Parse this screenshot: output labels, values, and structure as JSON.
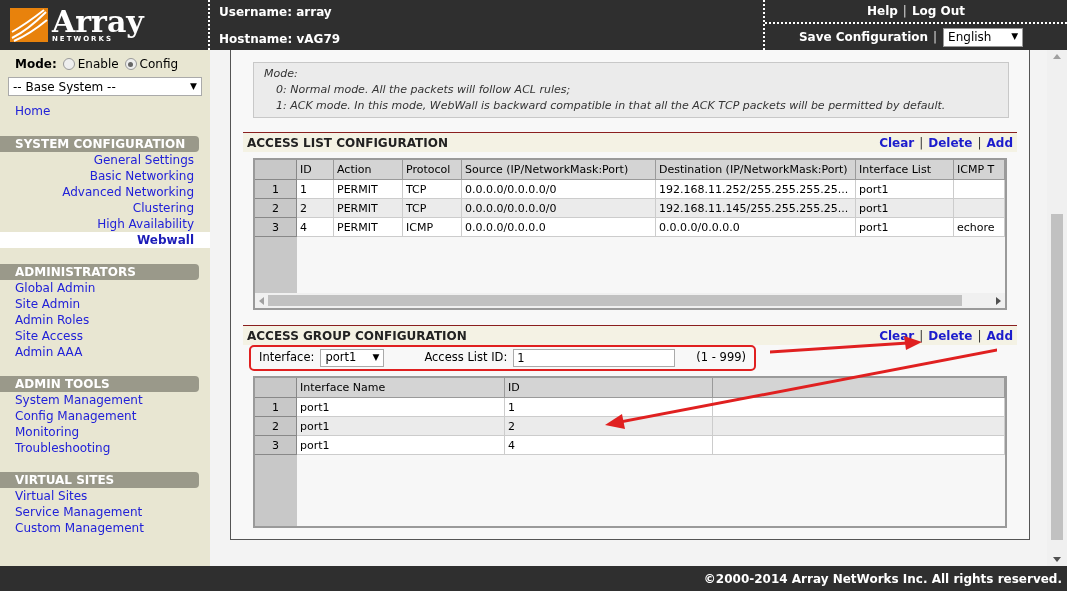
{
  "header": {
    "logo": {
      "name": "Array",
      "tagline": "NETWORKS"
    },
    "username": "Username: array",
    "hostname": "Hostname: vAG79",
    "top_links": [
      {
        "kind": "link",
        "text": "Help"
      },
      {
        "kind": "sep",
        "text": "|"
      },
      {
        "kind": "link",
        "text": "Log Out"
      }
    ],
    "save_links": [
      {
        "kind": "link",
        "text": "Save Configuration"
      },
      {
        "kind": "sep",
        "text": "|"
      }
    ],
    "language": {
      "value": "English",
      "caret": "▼"
    }
  },
  "sidebar": {
    "mode_label": "Mode:",
    "modes": [
      {
        "label": "Enable",
        "selected": false
      },
      {
        "label": "Config",
        "selected": true
      }
    ],
    "scope": {
      "value": "-- Base System --",
      "caret": "▼"
    },
    "home": "Home",
    "sections": [
      {
        "title": "SYSTEM CONFIGURATION",
        "items": [
          {
            "label": "General Settings",
            "selected": false
          },
          {
            "label": "Basic Networking",
            "selected": false
          },
          {
            "label": "Advanced Networking",
            "selected": false
          },
          {
            "label": "Clustering",
            "selected": false
          },
          {
            "label": "High Availability",
            "selected": false
          },
          {
            "label": "Webwall",
            "selected": true
          }
        ]
      },
      {
        "title": "ADMINISTRATORS",
        "items": [
          {
            "label": "Global Admin",
            "selected": false
          },
          {
            "label": "Site Admin",
            "selected": false
          },
          {
            "label": "Admin Roles",
            "selected": false
          },
          {
            "label": "Site Access",
            "selected": false
          },
          {
            "label": "Admin AAA",
            "selected": false
          }
        ]
      },
      {
        "title": "ADMIN TOOLS",
        "items": [
          {
            "label": "System Management",
            "selected": false
          },
          {
            "label": "Config Management",
            "selected": false
          },
          {
            "label": "Monitoring",
            "selected": false
          },
          {
            "label": "Troubleshooting",
            "selected": false
          }
        ]
      },
      {
        "title": "VIRTUAL SITES",
        "items": [
          {
            "label": "Virtual Sites",
            "selected": false
          },
          {
            "label": "Service Management",
            "selected": false
          },
          {
            "label": "Custom Management",
            "selected": false
          }
        ]
      }
    ]
  },
  "note": [
    "Mode:",
    "0: Normal mode. All the packets will follow ACL rules;",
    "1: ACK mode. In this mode, WebWall is backward compatible in that all the ACK TCP packets will be permitted by default."
  ],
  "access_list": {
    "title": "ACCESS LIST CONFIGURATION",
    "actions": [
      {
        "kind": "link",
        "text": "Clear"
      },
      {
        "kind": "sep",
        "text": "|"
      },
      {
        "kind": "link",
        "text": "Delete"
      },
      {
        "kind": "sep",
        "text": "|"
      },
      {
        "kind": "link",
        "text": "Add"
      }
    ],
    "columns": [
      "ID",
      "Action",
      "Protocol",
      "Source (IP/NetworkMask:Port)",
      "Destination (IP/NetworkMask:Port)",
      "Interface List",
      "ICMP T"
    ],
    "rows": [
      {
        "number": "1",
        "cells": [
          "1",
          "PERMIT",
          "TCP",
          "0.0.0.0/0.0.0.0/0",
          "192.168.11.252/255.255.255.25...",
          "port1",
          ""
        ]
      },
      {
        "number": "2",
        "cells": [
          "2",
          "PERMIT",
          "TCP",
          "0.0.0.0/0.0.0.0/0",
          "192.168.11.145/255.255.255.25...",
          "port1",
          ""
        ]
      },
      {
        "number": "3",
        "cells": [
          "4",
          "PERMIT",
          "ICMP",
          "0.0.0.0/0.0.0.0",
          "0.0.0.0/0.0.0.0",
          "port1",
          "echore"
        ]
      }
    ]
  },
  "access_group": {
    "title": "ACCESS GROUP CONFIGURATION",
    "actions": [
      {
        "kind": "link",
        "text": "Clear"
      },
      {
        "kind": "sep",
        "text": "|"
      },
      {
        "kind": "link",
        "text": "Delete"
      },
      {
        "kind": "sep",
        "text": "|"
      },
      {
        "kind": "link",
        "text": "Add"
      }
    ],
    "interface_label": "Interface:",
    "interface": {
      "value": "port1",
      "caret": "▼"
    },
    "list_id_label": "Access List ID:",
    "list_id": "1",
    "range": "(1 - 999)",
    "columns": [
      "Interface Name",
      "ID",
      ""
    ],
    "rows": [
      {
        "number": "1",
        "cells": [
          "port1",
          "1",
          ""
        ]
      },
      {
        "number": "2",
        "cells": [
          "port1",
          "2",
          ""
        ]
      },
      {
        "number": "3",
        "cells": [
          "port1",
          "4",
          ""
        ]
      }
    ]
  },
  "footer": "©2000-2014 Array NetWorks Inc. All rights reserved."
}
